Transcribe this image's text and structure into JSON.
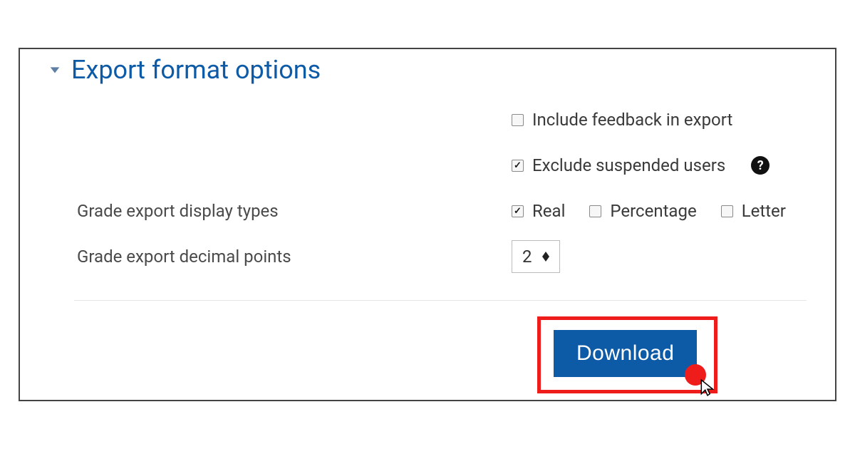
{
  "section": {
    "title": "Export format options"
  },
  "options": {
    "include_feedback": {
      "label": "Include feedback in export",
      "checked": false
    },
    "exclude_suspended": {
      "label": "Exclude suspended users",
      "checked": true
    }
  },
  "display_types": {
    "label": "Grade export display types",
    "real": {
      "label": "Real",
      "checked": true
    },
    "percentage": {
      "label": "Percentage",
      "checked": false
    },
    "letter": {
      "label": "Letter",
      "checked": false
    }
  },
  "decimal_points": {
    "label": "Grade export decimal points",
    "value": "2"
  },
  "actions": {
    "download": "Download"
  }
}
